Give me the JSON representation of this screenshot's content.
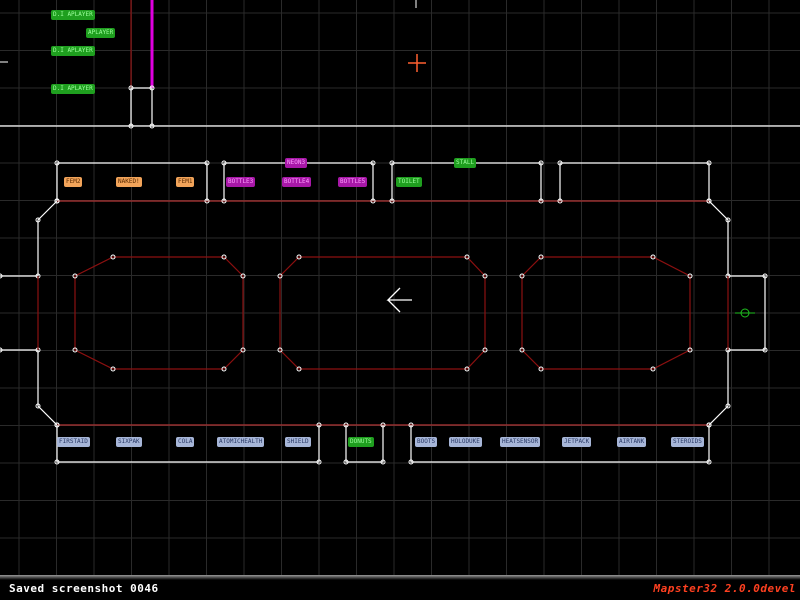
{
  "editor": {
    "status_message": "Saved screenshot 0046",
    "version": "Mapster32 2.0.0devel"
  },
  "colors": {
    "grid": "#2a2a2a",
    "white_wall": "#ffffff",
    "red_wall": "#8c1010",
    "magenta_wall": "#e000e0",
    "cursor": "#ff6030",
    "label_green": "#1f9f1f",
    "label_orange": "#f2a45a",
    "label_magenta": "#a818a8",
    "label_blue": "#a7b6d8"
  },
  "sprite_labels": {
    "dm_player_1": "D.I APLAYER",
    "aplayer": "APLAYER",
    "dm_player_2": "D.I APLAYER",
    "dm_player_3": "D.I APLAYER",
    "fem2": "FEM2",
    "naked": "NAKED!",
    "fem1": "FEM1",
    "neon": "NEON3",
    "bottle_1": "BOTTLE3",
    "bottle_2": "BOTTLE4",
    "bottle_3": "BOTTLE5",
    "toilet": "TOILET",
    "stall": "STALL",
    "firstaid": "FIRSTAID",
    "sixpak": "SIXPAK",
    "cola": "COLA",
    "atomichealth": "ATOMICHEALTH",
    "shield": "SHIELD",
    "donuts": "DONUTS",
    "boots": "BOOTS",
    "holoduke": "HOLODUKE",
    "heatsensor": "HEATSENSOR",
    "jetpack": "JETPACK",
    "airtank": "AIRTANK",
    "steroids": "STEROIDS"
  },
  "icons": {
    "cursor": "crosshair-cursor-icon",
    "player_arrow": "player-start-arrow-icon"
  }
}
